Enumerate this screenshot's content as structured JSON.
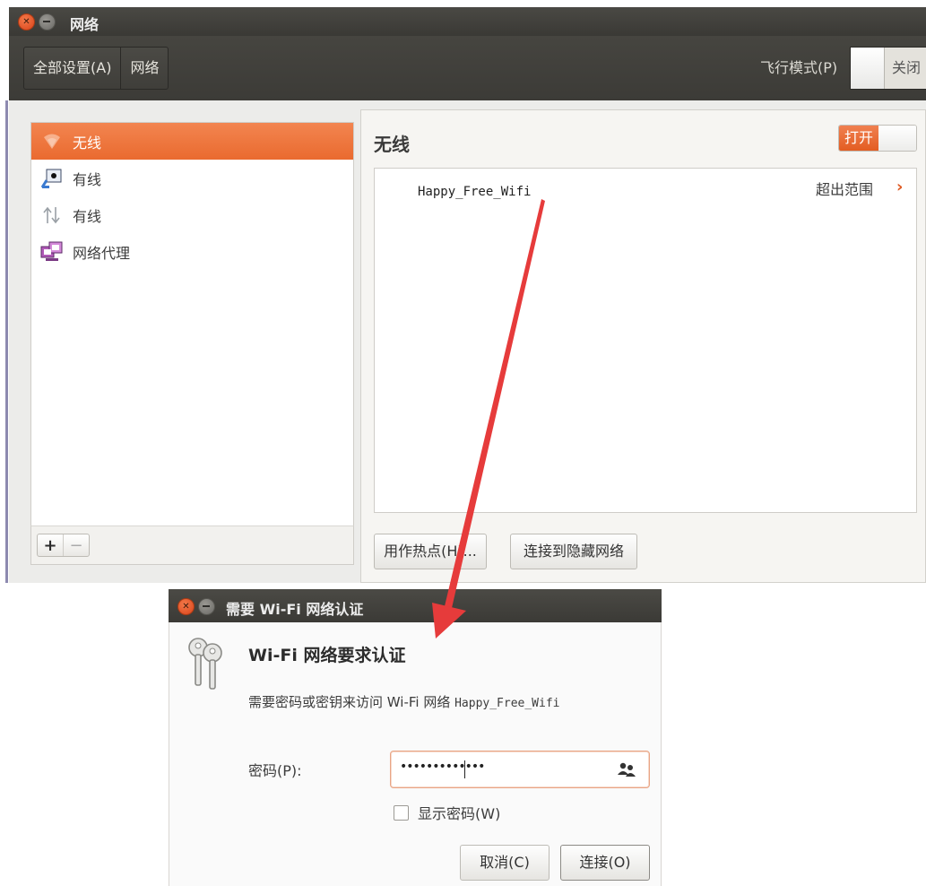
{
  "window": {
    "title": "网络",
    "breadcrumb": [
      "全部设置(A)",
      "网络"
    ],
    "airplane_mode_label": "飞行模式(P)",
    "airplane_mode_state": "关闭"
  },
  "sidebar": {
    "items": [
      {
        "label": "无线",
        "icon": "wifi-icon",
        "active": true
      },
      {
        "label": "有线",
        "icon": "wired-network-icon",
        "active": false
      },
      {
        "label": "有线",
        "icon": "network-transfer-icon",
        "active": false
      },
      {
        "label": "网络代理",
        "icon": "proxy-icon",
        "active": false
      }
    ],
    "add_label": "+",
    "remove_label": "−"
  },
  "wireless": {
    "title": "无线",
    "switch_state": "打开",
    "networks": [
      {
        "ssid": "Happy_Free_Wifi",
        "status": "超出范围"
      }
    ],
    "hotspot_button": "用作热点(H)...",
    "hidden_network_button": "连接到隐藏网络"
  },
  "dialog": {
    "title": "需要 Wi-Fi 网络认证",
    "heading": "Wi-Fi 网络要求认证",
    "description_prefix": "需要密码或密钥来访问 Wi-Fi 网络 ",
    "description_ssid": "Happy_Free_Wifi",
    "password_label": "密码(P):",
    "password_value": "•••••••••••••",
    "show_password_label": "显示密码(W)",
    "show_password_checked": false,
    "cancel_button": "取消(C)",
    "connect_button": "连接(O)"
  },
  "colors": {
    "accent": "#ea6a2f",
    "titlebar": "#3c3b37",
    "annotation_arrow": "#e63b3b"
  }
}
